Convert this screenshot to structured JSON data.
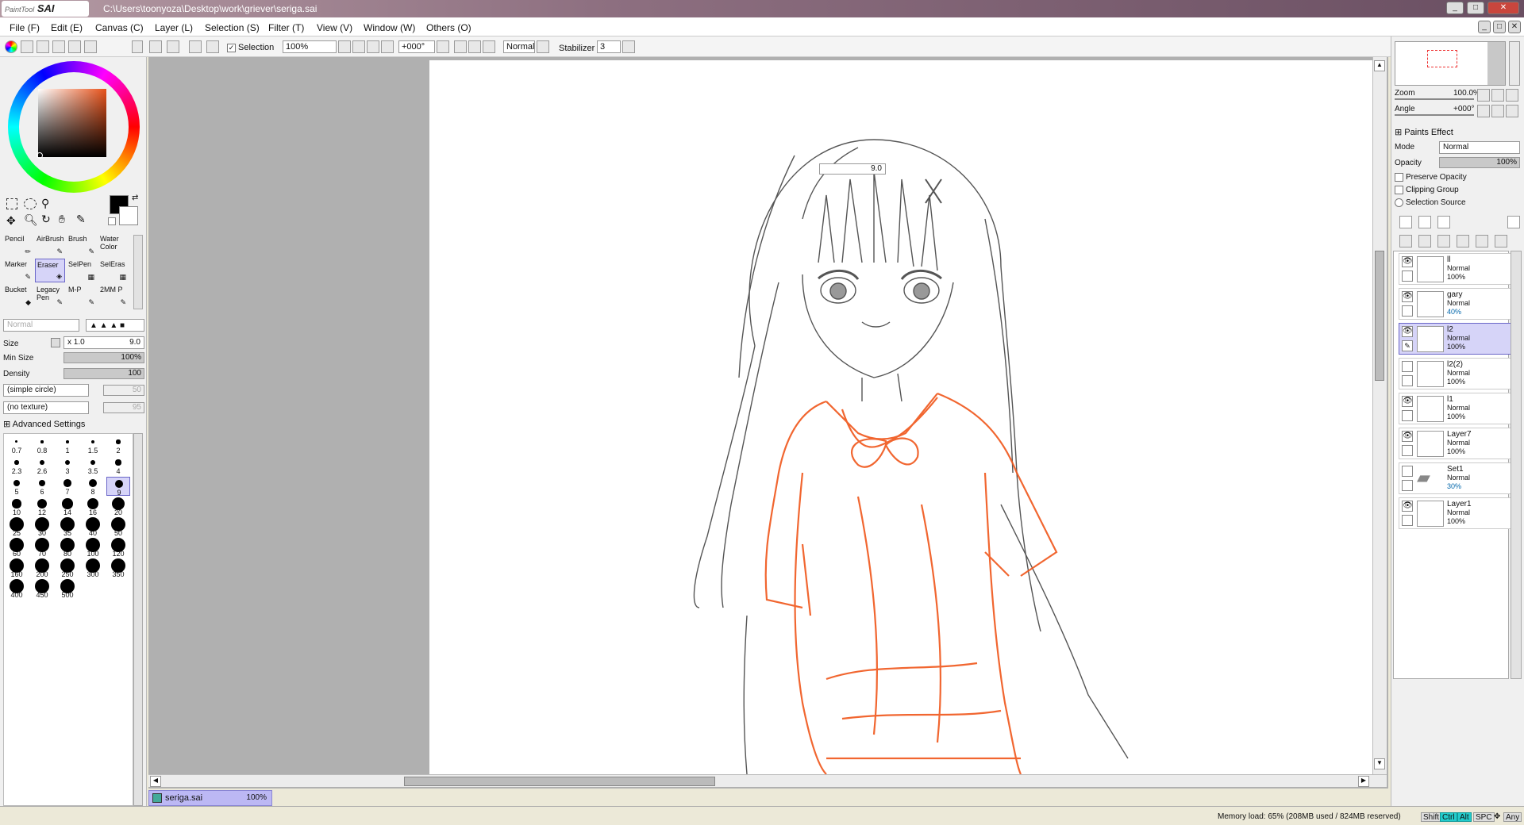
{
  "window": {
    "app_name": "PaintTool SAI",
    "logo_small": "PaintTool",
    "logo_big": "SAI",
    "file_path": "C:\\Users\\toonyoza\\Desktop\\work\\griever\\seriga.sai"
  },
  "menu": [
    "File (F)",
    "Edit (E)",
    "Canvas (C)",
    "Layer (L)",
    "Selection (S)",
    "Filter (T)",
    "View (V)",
    "Window (W)",
    "Others (O)"
  ],
  "toolbar": {
    "selection_label": "Selection",
    "zoom": "100%",
    "angle": "+000°",
    "blend": "Normal",
    "stabilizer_label": "Stabilizer",
    "stabilizer_value": "3"
  },
  "tools": [
    {
      "label": "Pencil",
      "label2": ""
    },
    {
      "label": "AirBrush",
      "label2": ""
    },
    {
      "label": "Brush",
      "label2": ""
    },
    {
      "label": "Water",
      "label2": "Color"
    },
    {
      "label": "Marker",
      "label2": ""
    },
    {
      "label": "Eraser",
      "label2": ""
    },
    {
      "label": "SelPen",
      "label2": ""
    },
    {
      "label": "SelEras",
      "label2": ""
    },
    {
      "label": "Bucket",
      "label2": ""
    },
    {
      "label": "Legacy",
      "label2": "Pen"
    },
    {
      "label": "M-P",
      "label2": ""
    },
    {
      "label": "2MM P",
      "label2": ""
    }
  ],
  "brush": {
    "blend_mode": "Normal",
    "size_label": "Size",
    "size_mult": "x 1.0",
    "size_value": "9.0",
    "min_size_label": "Min Size",
    "min_size_value": "100%",
    "density_label": "Density",
    "density_value": "100",
    "shape": "(simple circle)",
    "shape_value": "50",
    "texture": "(no texture)",
    "texture_value": "95",
    "advanced_label": "Advanced Settings"
  },
  "brush_sizes": [
    "0.7",
    "0.8",
    "1",
    "1.5",
    "2",
    "2.3",
    "2.6",
    "3",
    "3.5",
    "4",
    "5",
    "6",
    "7",
    "8",
    "9",
    "10",
    "12",
    "14",
    "16",
    "20",
    "25",
    "30",
    "35",
    "40",
    "50",
    "60",
    "70",
    "80",
    "100",
    "120",
    "160",
    "200",
    "250",
    "300",
    "350",
    "400",
    "450",
    "500"
  ],
  "canvas": {
    "size_popup": "9.0",
    "file_tab_name": "seriga.sai",
    "file_tab_zoom": "100%"
  },
  "navigator": {
    "zoom_label": "Zoom",
    "zoom_value": "100.0%",
    "angle_label": "Angle",
    "angle_value": "+000°"
  },
  "layer_props": {
    "paints_effect": "Paints Effect",
    "mode_label": "Mode",
    "mode_value": "Normal",
    "opacity_label": "Opacity",
    "opacity_value": "100%",
    "preserve_opacity": "Preserve Opacity",
    "clipping_group": "Clipping Group",
    "selection_source": "Selection Source"
  },
  "layers": [
    {
      "name": "ll",
      "mode": "Normal",
      "opacity": "100%",
      "visible": true,
      "selected": false
    },
    {
      "name": "gary",
      "mode": "Normal",
      "opacity": "40%",
      "visible": true,
      "selected": false
    },
    {
      "name": "l2",
      "mode": "Normal",
      "opacity": "100%",
      "visible": true,
      "selected": true
    },
    {
      "name": "l2(2)",
      "mode": "Normal",
      "opacity": "100%",
      "visible": false,
      "selected": false
    },
    {
      "name": "l1",
      "mode": "Normal",
      "opacity": "100%",
      "visible": true,
      "selected": false
    },
    {
      "name": "Layer7",
      "mode": "Normal",
      "opacity": "100%",
      "visible": true,
      "selected": false
    },
    {
      "name": "Set1",
      "mode": "Normal",
      "opacity": "30%",
      "visible": false,
      "selected": false
    },
    {
      "name": "Layer1",
      "mode": "Normal",
      "opacity": "100%",
      "visible": true,
      "selected": false
    }
  ],
  "status": {
    "memory": "Memory load: 65% (208MB used / 824MB reserved)",
    "indicators": [
      "Shift",
      "Ctrl",
      "Alt",
      "SPC",
      "Any"
    ]
  },
  "colors": {
    "accent_selected": "#d6d4f8",
    "sketch_orange": "#f0561a",
    "primary_color": "#000000"
  }
}
